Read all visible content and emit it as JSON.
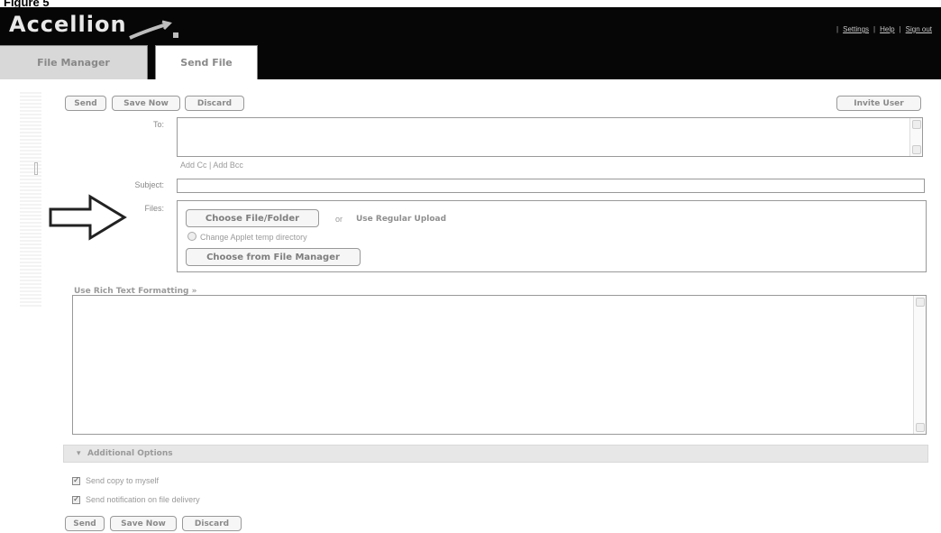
{
  "caption": "Figure 5",
  "header": {
    "logo": "Accellion",
    "links": [
      "Settings",
      "Help",
      "Sign out"
    ]
  },
  "tabs": [
    {
      "label": "File Manager"
    },
    {
      "label": "Send File"
    }
  ],
  "toolbar": {
    "send": "Send",
    "save_now": "Save Now",
    "discard": "Discard",
    "invite_user": "Invite User"
  },
  "form": {
    "to_label": "To:",
    "cc_bcc": "Add Cc | Add Bcc",
    "subject_label": "Subject:",
    "files_label": "Files:",
    "choose_file_folder": "Choose File/Folder",
    "or": "or",
    "use_regular_upload": "Use Regular Upload",
    "change_temp_dir": "Change Applet temp directory",
    "choose_from_file_manager": "Choose from File Manager",
    "rich_text": "Use Rich Text Formatting »"
  },
  "options": {
    "title": "Additional Options",
    "send_copy": "Send copy to myself",
    "send_notification": "Send notification on file delivery"
  },
  "footer": {
    "send": "Send",
    "save_now": "Save Now",
    "discard": "Discard"
  }
}
